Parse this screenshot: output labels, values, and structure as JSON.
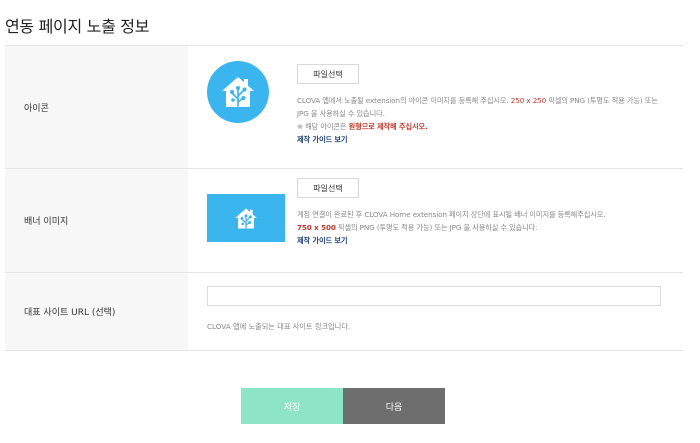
{
  "page_title": "연동 페이지 노출 정보",
  "icon_row": {
    "label": "아이콘",
    "file_button": "파일선택",
    "desc_pre": "CLOVA 앱에서 노출될 extension의 아이콘 이미지를 등록해 주십시오. ",
    "desc_size": "250 x 250",
    "desc_post": " 픽셀의 PNG (투명도 적용 가능) 또는 JPG 을 사용하실 수 있습니다.",
    "note_pre": "※ 해당 아이콘은 ",
    "note_highlight": "원형으로 제작해 주십시오.",
    "guide_link": "제작 가이드 보기",
    "icon_image": "home-tree-icon"
  },
  "banner_row": {
    "label": "배너 이미지",
    "file_button": "파일선택",
    "desc_pre": "계정 연결이 완료된 후 CLOVA Home extension 페이지 상단에 표시될 배너 이미지를 등록해주십시오.",
    "desc_size": "750 x 500",
    "desc_post": " 픽셀의 PNG (투명도 적용 가능) 또는 JPG 을 사용하실 수 있습니다.",
    "guide_link": "제작 가이드 보기",
    "banner_image": "home-tree-icon"
  },
  "url_row": {
    "label": "대표 사이트 URL (선택)",
    "input_value": "",
    "hint": "CLOVA 앱에 노출되는 대표 사이트 링크입니다."
  },
  "actions": {
    "save_label": "저장",
    "next_label": "다음"
  },
  "colors": {
    "icon_bg": "#3bb5ee",
    "save_bg": "#8ee4c7",
    "next_bg": "#6e6e6e",
    "highlight": "#c0392b",
    "link": "#1b3d6f"
  }
}
